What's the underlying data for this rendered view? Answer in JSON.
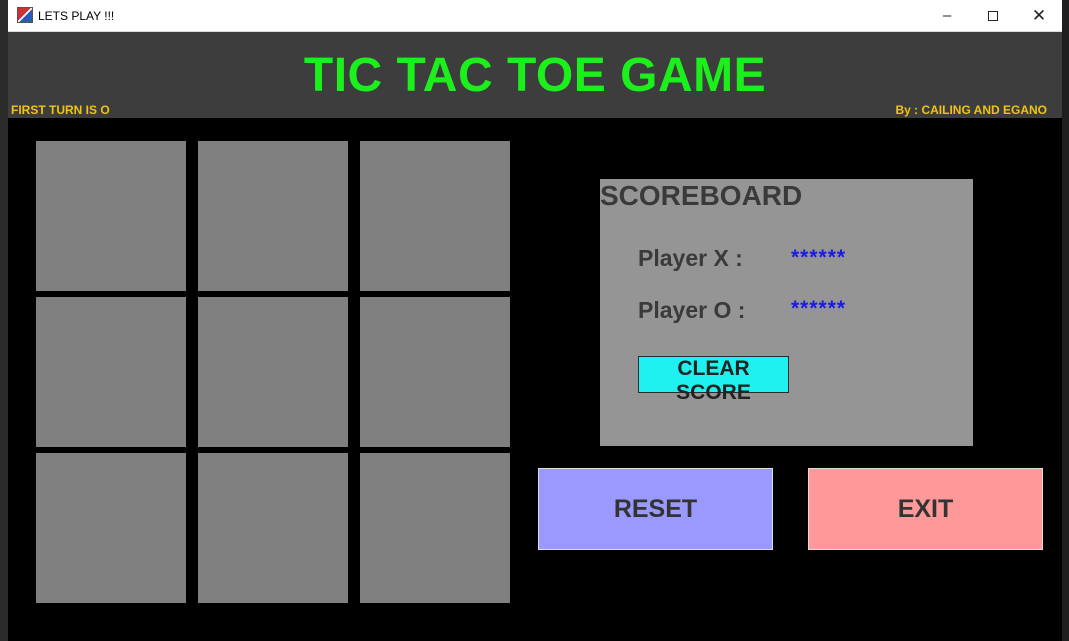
{
  "window": {
    "title": "LETS PLAY !!!",
    "controls": {
      "minimize": "–",
      "close": "✕"
    }
  },
  "header": {
    "title": "TIC TAC TOE GAME",
    "turn_text": "FIRST TURN IS O",
    "author_text": "By : CAILING AND EGANO"
  },
  "board": {
    "cells": [
      "",
      "",
      "",
      "",
      "",
      "",
      "",
      "",
      ""
    ]
  },
  "scoreboard": {
    "title": "SCOREBOARD",
    "player_x_label": "Player X :",
    "player_x_score": "******",
    "player_o_label": "Player O :",
    "player_o_score": "******",
    "clear_label": "CLEAR SCORE"
  },
  "buttons": {
    "reset_label": "RESET",
    "exit_label": "EXIT"
  },
  "colors": {
    "title_green": "#1cf01c",
    "label_yellow": "#f1c40f",
    "cell_gray": "#808080",
    "scoreboard_gray": "#959595",
    "score_blue": "#1a1ae6",
    "clear_cyan": "#1ff0f0",
    "reset_blue": "#9999ff",
    "exit_pink": "#ff9999"
  }
}
